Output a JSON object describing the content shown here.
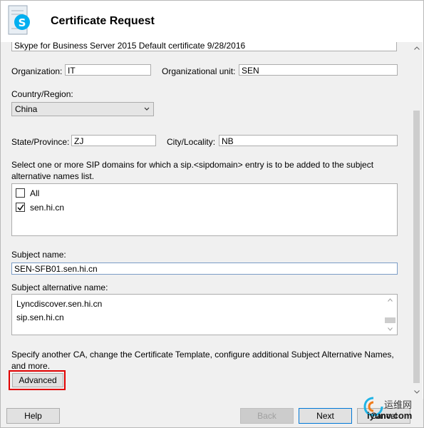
{
  "window": {
    "title": "Certificate Request"
  },
  "icon": {
    "name": "skype-certificate-icon"
  },
  "form": {
    "friendly_name_value": "Skype for Business Server 2015 Default certificate 9/28/2016",
    "organization_label": "Organization:",
    "organization_value": "IT",
    "org_unit_label": "Organizational unit:",
    "org_unit_value": "SEN",
    "country_label": "Country/Region:",
    "country_value": "China",
    "state_label": "State/Province:",
    "state_value": "ZJ",
    "city_label": "City/Locality:",
    "city_value": "NB",
    "sip_instruction": "Select one or more SIP domains for which a sip.<sipdomain> entry is to be added to the subject",
    "sip_instruction_2": "alternative names list.",
    "sip_domains": [
      {
        "label": "All",
        "checked": false
      },
      {
        "label": "sen.hi.cn",
        "checked": true
      }
    ],
    "subject_name_label": "Subject name:",
    "subject_name_value": "SEN-SFB01.sen.hi.cn",
    "san_label": "Subject alternative name:",
    "san_values": [
      "Lyncdiscover.sen.hi.cn",
      "sip.sen.hi.cn"
    ],
    "advanced_text": "Specify another CA, change the Certificate Template, configure additional Subject Alternative Names,",
    "advanced_text_2": "and more.",
    "advanced_button": "Advanced"
  },
  "footer": {
    "help": "Help",
    "back": "Back",
    "next": "Next",
    "cancel": "Cancel"
  },
  "watermark": {
    "text_cn": "运维网",
    "text_en": "iyunv.com"
  },
  "colors": {
    "highlight_red": "#e00000",
    "focus_blue": "#7a9cc6",
    "accent": "#0078d7"
  }
}
